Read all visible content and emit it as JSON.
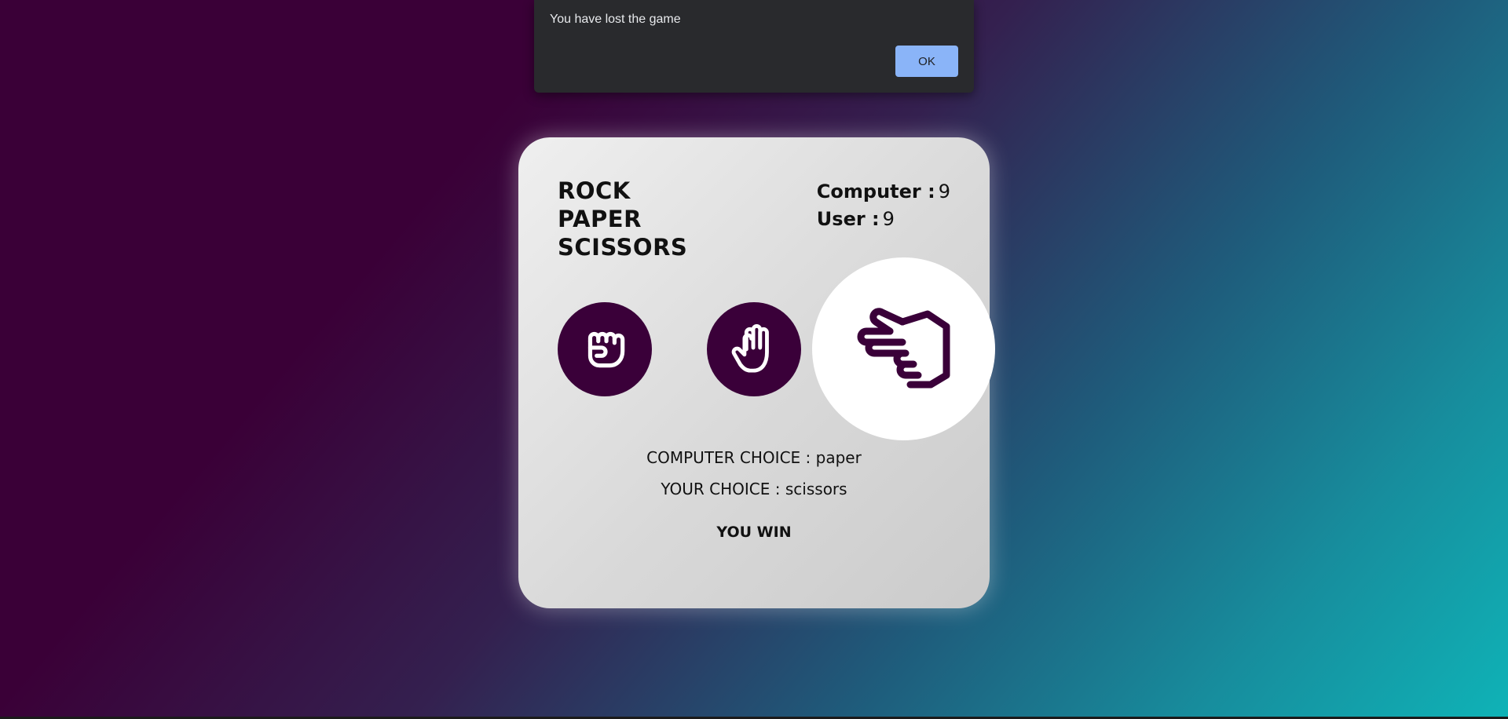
{
  "alert": {
    "message": "You have lost the game",
    "ok_label": "OK"
  },
  "game": {
    "title_lines": [
      "ROCK",
      "PAPER",
      "SCISSORS"
    ],
    "scores": {
      "computer_label": "Computer :",
      "computer_value": "9",
      "user_label": "User :",
      "user_value": "9"
    },
    "choices": [
      {
        "name": "rock",
        "icon": "rock-fist-icon"
      },
      {
        "name": "paper",
        "icon": "paper-hand-icon"
      },
      {
        "name": "scissors",
        "icon": "scissors-hand-icon",
        "selected": true
      }
    ],
    "computer_choice_label": "COMPUTER CHOICE :",
    "computer_choice_value": "paper",
    "your_choice_label": "YOUR CHOICE :",
    "your_choice_value": "scissors",
    "result": "YOU WIN"
  },
  "colors": {
    "accent": "#3a0039",
    "selected_bg": "#ffffff",
    "ok_button": "#8ab4f8",
    "dialog_bg": "#292a2d"
  }
}
